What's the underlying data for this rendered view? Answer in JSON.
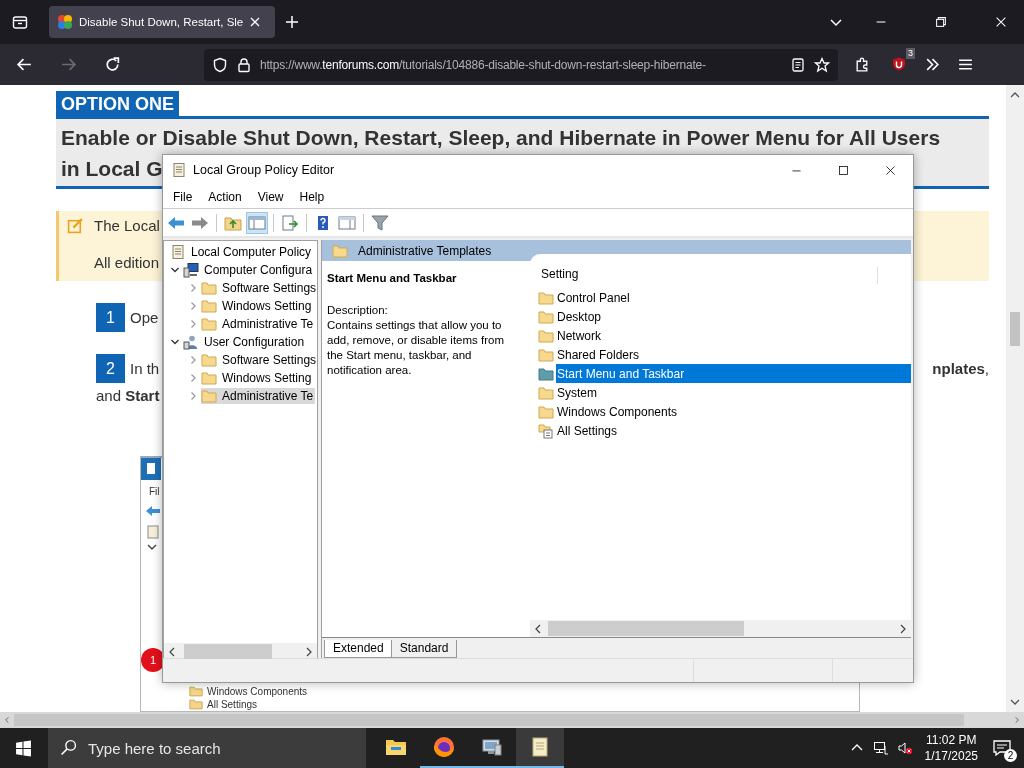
{
  "browser": {
    "tab": {
      "title": "Disable Shut Down, Restart, Sle",
      "selected": true
    },
    "url": {
      "prefix": "https://www.",
      "domain": "tenforums.com",
      "path": "/tutorials/104886-disable-shut-down-restart-sleep-hibernate-"
    },
    "forward_disabled": true,
    "extension_badge": "3"
  },
  "article": {
    "option_label": "OPTION ONE",
    "heading_lines": [
      "Enable or Disable Shut Down, Restart, Sleep, and Hibernate in Power Menu for All Users",
      "in Local G"
    ],
    "note_lines": [
      "The Local",
      "All edition"
    ],
    "steps": [
      {
        "number": "1",
        "text": "Ope"
      },
      {
        "number": "2",
        "text": "In th",
        "text_right": "**nplates**,",
        "line_2": "and **Start**"
      }
    ],
    "embedded_screenshot": {
      "menu": "Fil",
      "tree_items": [
        "Windows Components",
        "All Settings"
      ],
      "badge": "1"
    }
  },
  "dialog": {
    "title": "Local Group Policy Editor",
    "menu": [
      "File",
      "Action",
      "View",
      "Help"
    ],
    "toolbar_groups": [
      [
        {
          "kind": "back",
          "pressed": false
        },
        {
          "kind": "forward",
          "pressed": false
        }
      ],
      [
        {
          "kind": "up",
          "pressed": false
        },
        {
          "kind": "tree",
          "pressed": true
        }
      ],
      [
        {
          "kind": "export",
          "pressed": false
        }
      ],
      [
        {
          "kind": "help",
          "pressed": false
        },
        {
          "kind": "pane",
          "pressed": false
        }
      ],
      [
        {
          "kind": "filter",
          "pressed": false
        }
      ]
    ],
    "tree": [
      {
        "label": "Local Computer Policy",
        "kind": "policy",
        "selected": false,
        "children": [
          {
            "label": "Computer Configura",
            "kind": "computer",
            "expanded": true,
            "selected": false,
            "children": [
              {
                "label": "Software Settings",
                "kind": "folder",
                "expanded": false,
                "selected": false
              },
              {
                "label": "Windows Setting",
                "kind": "folder",
                "expanded": false,
                "selected": false
              },
              {
                "label": "Administrative Te",
                "kind": "folder",
                "expanded": false,
                "selected": false
              }
            ]
          },
          {
            "label": "User Configuration",
            "kind": "user",
            "expanded": true,
            "selected": false,
            "children": [
              {
                "label": "Software Settings",
                "kind": "folder",
                "expanded": false,
                "selected": false
              },
              {
                "label": "Windows Setting",
                "kind": "folder",
                "expanded": false,
                "selected": false
              },
              {
                "label": "Administrative Te",
                "kind": "folder",
                "expanded": false,
                "selected": true
              }
            ]
          }
        ]
      }
    ],
    "header": "Administrative Templates",
    "description": {
      "title": "Start Menu and Taskbar",
      "label": "Description:",
      "text": "Contains settings that allow you to add, remove, or disable items from the Start menu, taskbar, and notification area."
    },
    "list_header": "Setting",
    "items": [
      {
        "label": "Control Panel",
        "kind": "folder",
        "selected": false
      },
      {
        "label": "Desktop",
        "kind": "folder",
        "selected": false
      },
      {
        "label": "Network",
        "kind": "folder",
        "selected": false
      },
      {
        "label": "Shared Folders",
        "kind": "folder",
        "selected": false
      },
      {
        "label": "Start Menu and Taskbar",
        "kind": "folder",
        "selected": true
      },
      {
        "label": "System",
        "kind": "folder",
        "selected": false
      },
      {
        "label": "Windows Components",
        "kind": "folder",
        "selected": false
      },
      {
        "label": "All Settings",
        "kind": "all-settings",
        "selected": false
      }
    ],
    "tabs": [
      {
        "label": "Extended",
        "selected": true
      },
      {
        "label": "Standard",
        "selected": false
      }
    ]
  },
  "taskbar": {
    "search": {
      "placeholder": "Type here to search"
    },
    "apps": [
      {
        "kind": "explorer",
        "running": false,
        "active": false
      },
      {
        "kind": "firefox",
        "running": true,
        "active": false
      },
      {
        "kind": "monitor",
        "running": true,
        "active": false
      },
      {
        "kind": "notepad",
        "running": true,
        "active": true
      }
    ],
    "time": "11:02 PM",
    "date": "1/17/2025",
    "notifications": "2"
  }
}
